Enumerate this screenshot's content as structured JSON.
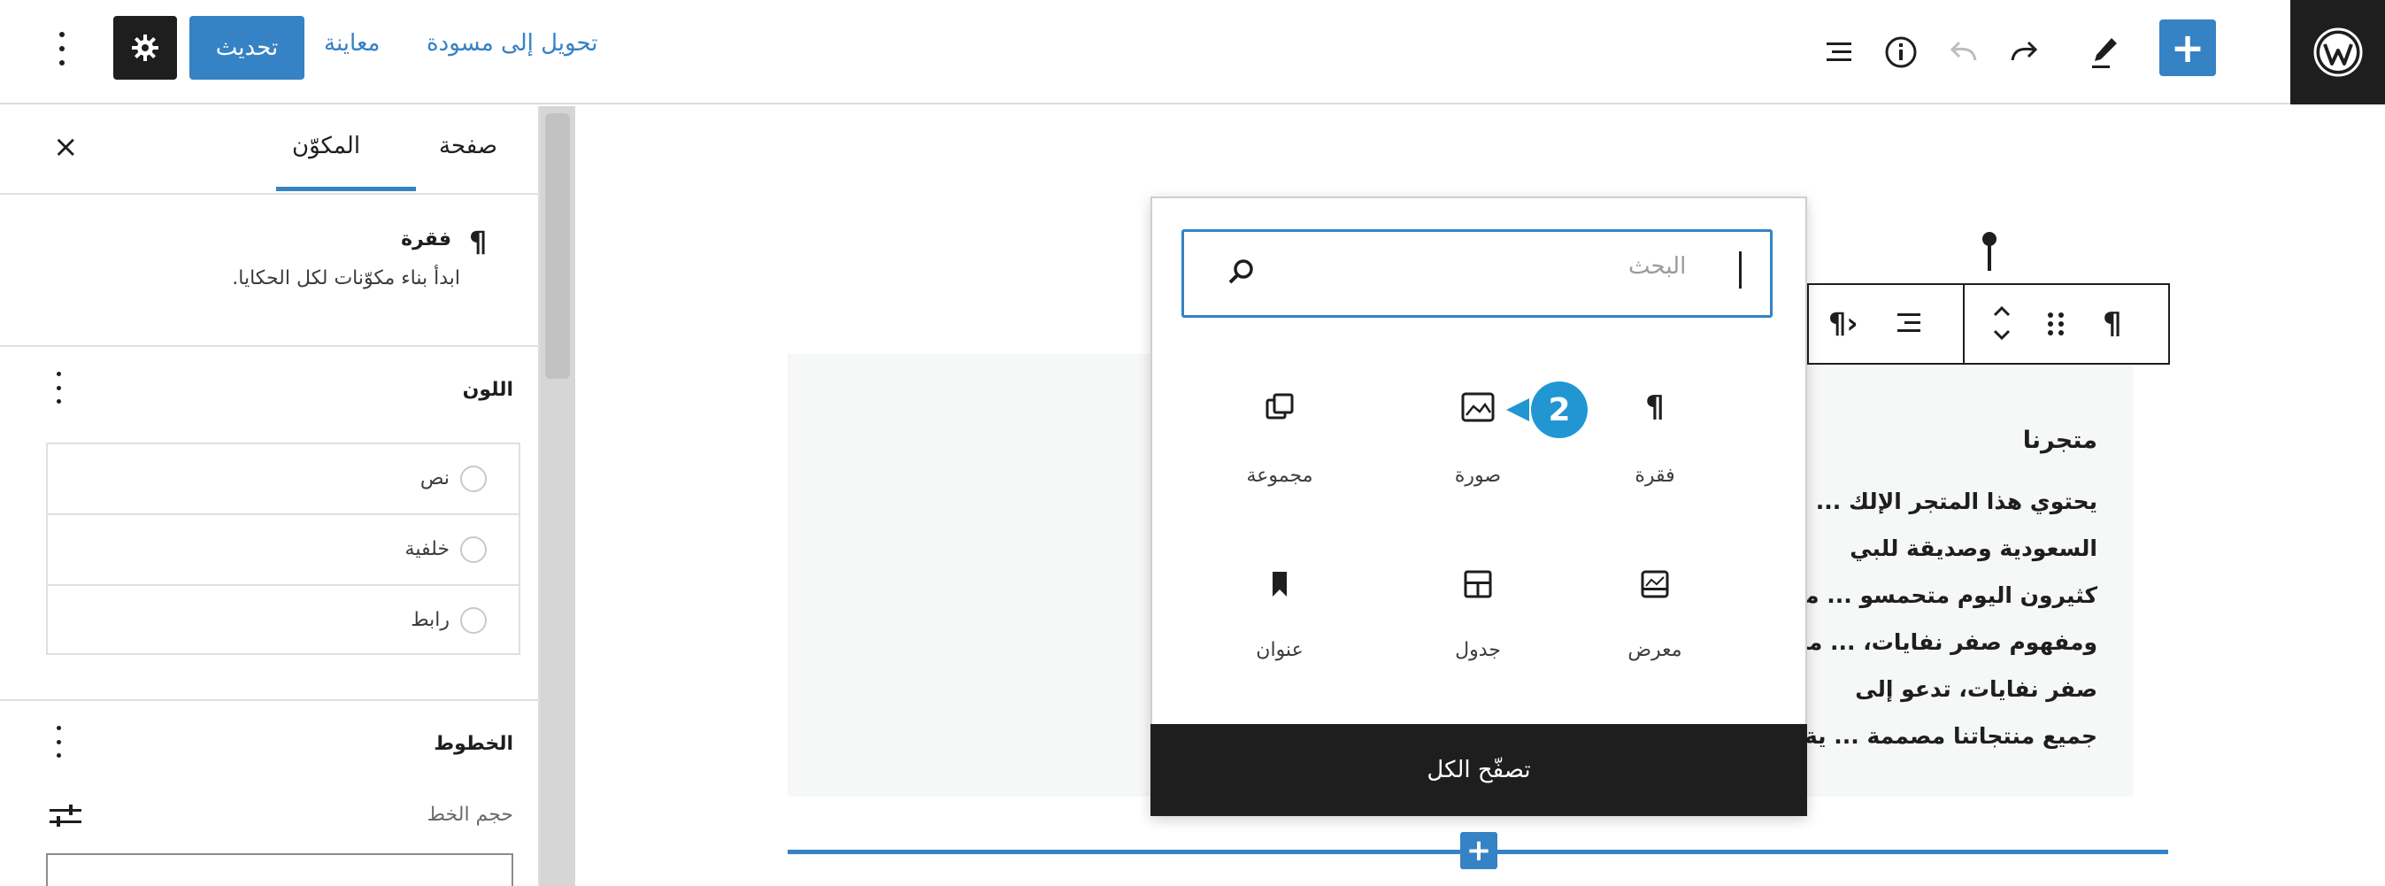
{
  "topbar": {
    "publish_label": "تحديث",
    "preview_label": "معاينة",
    "draft_label": "تحويل إلى مسودة",
    "add_block_label": "+",
    "logo_icon": "wordpress-logo-icon",
    "accent_color": "#3582c4"
  },
  "sidebar": {
    "tabs": [
      "صفحة",
      "المكوّن"
    ],
    "close_label": "×",
    "block_card": {
      "icon": "paragraph-icon",
      "title": "فقرة",
      "description": "ابدأ بناء مكوّنات لكل الحكايا."
    },
    "color_panel": {
      "title": "اللون",
      "options": [
        "نص",
        "خلفية",
        "رابط"
      ]
    },
    "typography_panel": {
      "title": "الخطوط",
      "size_label": "حجم الخط"
    }
  },
  "editor": {
    "heading": "متجرنا",
    "lines": [
      "يحتوي هذا المتجر الإلك ... في المملكة العربية",
      "السعودية وصديقة للبي",
      "كثيرون اليوم متحمسو ... مر فقط بتوفير المال،",
      "ومفهوم صفر نفايات، ... من هذه الحرفة. مفهوم",
      "صفر نفايات، تدعو إلى",
      "جميع منتجاتنا مصممة ... ية."
    ],
    "appender_label": "+"
  },
  "inserter": {
    "search_placeholder": "البحث",
    "blocks": [
      {
        "label": "فقرة",
        "icon": "paragraph-icon"
      },
      {
        "label": "صورة",
        "icon": "image-icon"
      },
      {
        "label": "مجموعة",
        "icon": "group-icon"
      },
      {
        "label": "معرض",
        "icon": "gallery-icon"
      },
      {
        "label": "جدول",
        "icon": "table-icon"
      },
      {
        "label": "عنوان",
        "icon": "heading-icon"
      }
    ],
    "browse_all_label": "تصفّح الكل"
  },
  "callout": {
    "number": "2",
    "color": "#2196d3"
  }
}
